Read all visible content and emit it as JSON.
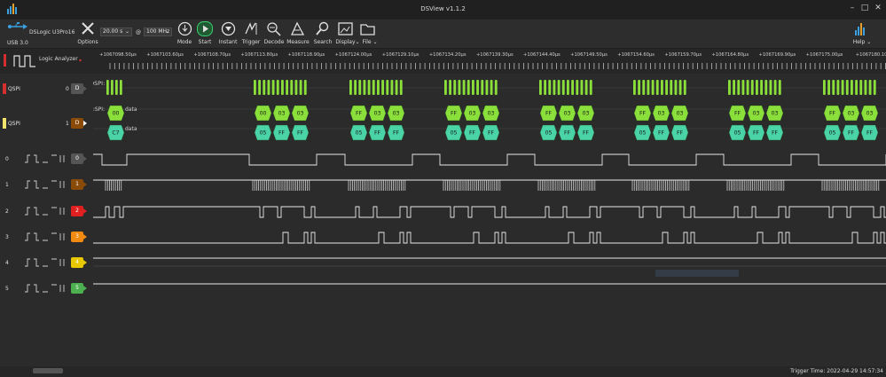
{
  "window": {
    "title": "DSView v1.1.2"
  },
  "device": {
    "name": "DSLogic U3Pro16",
    "interface": "USB 3.0",
    "options_label": "Options"
  },
  "capture": {
    "duration": "20.00 s",
    "rate": "100 MHz"
  },
  "toolbar": {
    "mode": "Mode",
    "start": "Start",
    "instant": "Instant",
    "trigger": "Trigger",
    "decode": "Decode",
    "measure": "Measure",
    "search": "Search",
    "display": "Display",
    "file": "File",
    "help": "Help"
  },
  "panel": {
    "title": "Logic Analyzer"
  },
  "ruler": {
    "ticks": [
      "+1067098.50µs",
      "+1067103.60µs",
      "+1067108.70µs",
      "+1067113.80µs",
      "+1067118.90µs",
      "+1067124.00µs",
      "+1067129.10µs",
      "+1067134.20µs",
      "+1067139.30µs",
      "+1067144.40µs",
      "+1067149.50µs",
      "+1067154.60µs",
      "+1067159.70µs",
      "+1067164.80µs",
      "+1067169.90µs",
      "+1067175.00µs",
      "+1067180.10"
    ]
  },
  "decoders": [
    {
      "name": "QSPI",
      "index": "0",
      "badge": "D",
      "color": "#d32f2f"
    },
    {
      "name": "QSPI",
      "index": "1",
      "badge": "D",
      "color": "#f1e36b"
    }
  ],
  "annotation_rows": {
    "row0_label": "0:SPI:",
    "row0_title": "data",
    "row1_label": "0:SPI:",
    "row1_title": "data",
    "decoder_label": "QSPI:"
  },
  "bursts": [
    {
      "top": [
        "00",
        "03",
        "03"
      ],
      "bottom": [
        "C7",
        "",
        ""
      ],
      "single": true
    },
    {
      "top": [
        "00",
        "03",
        "03"
      ],
      "bottom": [
        "05",
        "FF",
        "FF"
      ]
    },
    {
      "top": [
        "FF",
        "03",
        "03"
      ],
      "bottom": [
        "05",
        "FF",
        "FF"
      ]
    },
    {
      "top": [
        "FF",
        "03",
        "03"
      ],
      "bottom": [
        "05",
        "FF",
        "FF"
      ]
    },
    {
      "top": [
        "FF",
        "03",
        "03"
      ],
      "bottom": [
        "05",
        "FF",
        "FF"
      ]
    },
    {
      "top": [
        "FF",
        "03",
        "03"
      ],
      "bottom": [
        "05",
        "FF",
        "FF"
      ]
    },
    {
      "top": [
        "FF",
        "03",
        "03"
      ],
      "bottom": [
        "05",
        "FF",
        "FF"
      ]
    },
    {
      "top": [
        "FF",
        "03",
        "03"
      ],
      "bottom": [
        "05",
        "FF",
        "FF"
      ]
    }
  ],
  "channels": [
    {
      "index": "0",
      "badge": "0",
      "color": "#555555"
    },
    {
      "index": "1",
      "badge": "1",
      "color": "#8a4b08"
    },
    {
      "index": "2",
      "badge": "2",
      "color": "#e02020"
    },
    {
      "index": "3",
      "badge": "3",
      "color": "#f08a10"
    },
    {
      "index": "4",
      "badge": "4",
      "color": "#e8c800"
    },
    {
      "index": "5",
      "badge": "5",
      "color": "#4caf50"
    }
  ],
  "colors": {
    "wave": "#e8e8e8",
    "decode_green": "#8bdf3a",
    "decode_teal": "#49d3a6",
    "background": "#2b2b2b"
  },
  "status": {
    "trigger_time": "Trigger Time: 2022-04-29 14:57:34"
  }
}
